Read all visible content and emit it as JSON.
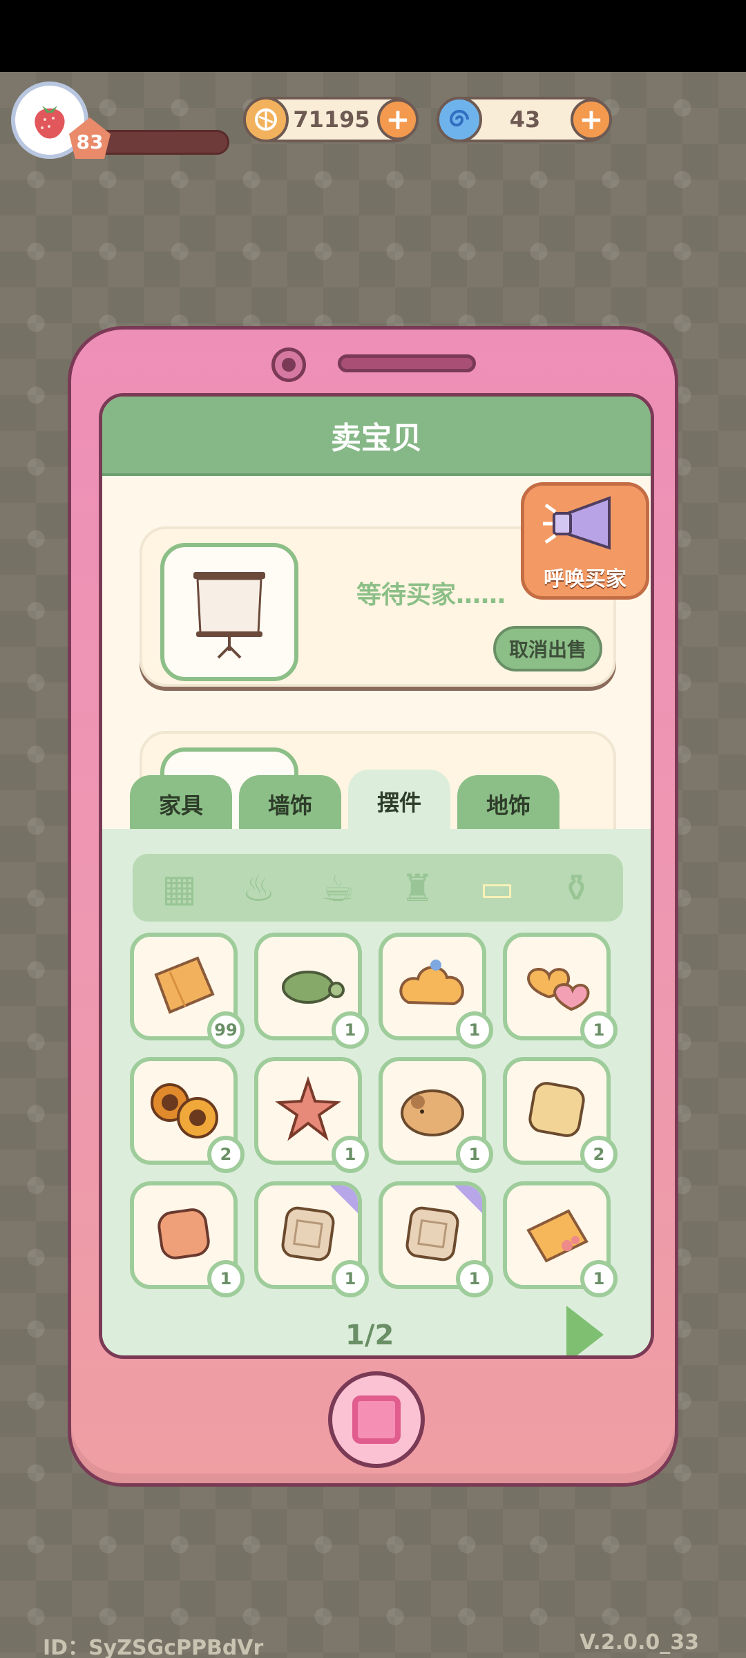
{
  "hud": {
    "level": "83",
    "level_progress": 0.2,
    "coins": "71195",
    "gems": "43",
    "avatar_icon": "strawberry-icon",
    "coin_icon": "coin-icon",
    "gem_icon": "swirl-gem-icon"
  },
  "phone": {
    "title": "卖宝贝",
    "listing": {
      "status": "等待买家……",
      "cancel_label": "取消出售",
      "item_icon": "projector-screen-icon"
    },
    "call_buyer_label": "呼唤买家",
    "tabs": [
      {
        "label": "家具",
        "active": false
      },
      {
        "label": "墙饰",
        "active": false
      },
      {
        "label": "摆件",
        "active": true
      },
      {
        "label": "地饰",
        "active": false
      }
    ],
    "categories": [
      "grid-all-icon",
      "pot-icon",
      "cup-icon",
      "lamp-icon",
      "pillow-icon",
      "vase-icon"
    ],
    "selected_category": 4,
    "items": [
      {
        "icon": "pillow-orange-icon",
        "qty": "99"
      },
      {
        "icon": "turtle-icon",
        "qty": "1"
      },
      {
        "icon": "cloud-cushion-icon",
        "qty": "1"
      },
      {
        "icon": "heart-cushions-icon",
        "qty": "1"
      },
      {
        "icon": "sunflower-cushions-icon",
        "qty": "2"
      },
      {
        "icon": "starfish-icon",
        "qty": "1"
      },
      {
        "icon": "capybara-cushion-icon",
        "qty": "1"
      },
      {
        "icon": "cream-cushion-icon",
        "qty": "2"
      },
      {
        "icon": "peach-cushion-icon",
        "qty": "1"
      },
      {
        "icon": "patterned-cushion-icon",
        "qty": "1"
      },
      {
        "icon": "patterned-cushion-icon",
        "qty": "1"
      },
      {
        "icon": "floral-cushion-icon",
        "qty": "1"
      }
    ],
    "page": "1/2"
  },
  "footer": {
    "id": "ID：SyZSGcPPBdVr",
    "version": "V.2.0.0_33"
  }
}
